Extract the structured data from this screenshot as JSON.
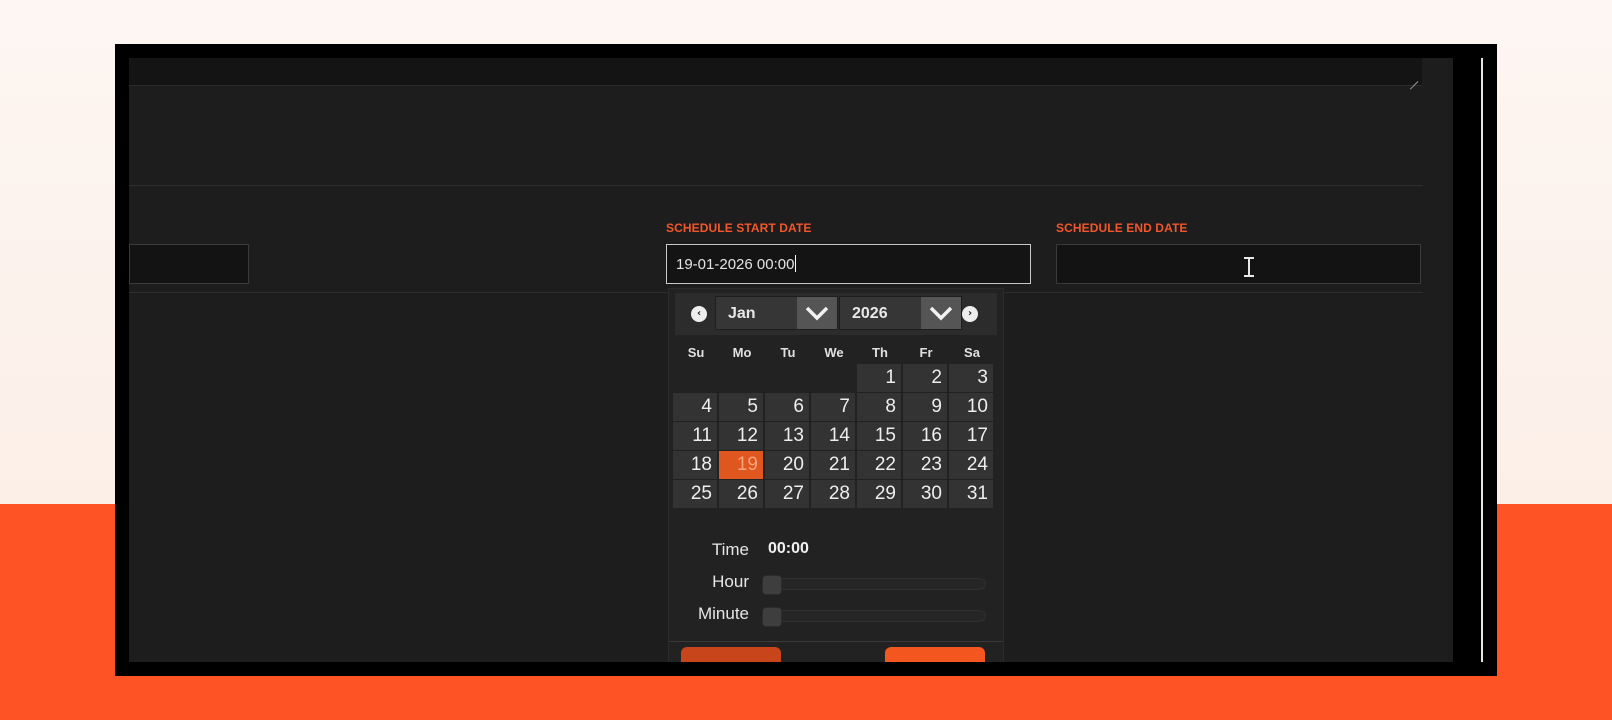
{
  "schedule": {
    "start_label": "SCHEDULE START DATE",
    "start_value": "19-01-2026 00:00",
    "end_label": "SCHEDULE END DATE",
    "end_value": ""
  },
  "datepicker": {
    "month": "Jan",
    "year": "2026",
    "weekdays": [
      "Su",
      "Mo",
      "Tu",
      "We",
      "Th",
      "Fr",
      "Sa"
    ],
    "selected_day": "19",
    "time_label": "Time",
    "time_value": "00:00",
    "hour_label": "Hour",
    "minute_label": "Minute",
    "hour_value": 0,
    "minute_value": 0
  },
  "colors": {
    "accent": "#f2562a",
    "today_bg": "#e0561f",
    "background_orange": "#fe5324"
  },
  "icons": {
    "prev": "chevron-left-circle-icon",
    "next": "chevron-right-circle-icon",
    "dropdown": "chevron-down-icon",
    "cursor": "text-cursor-icon"
  }
}
